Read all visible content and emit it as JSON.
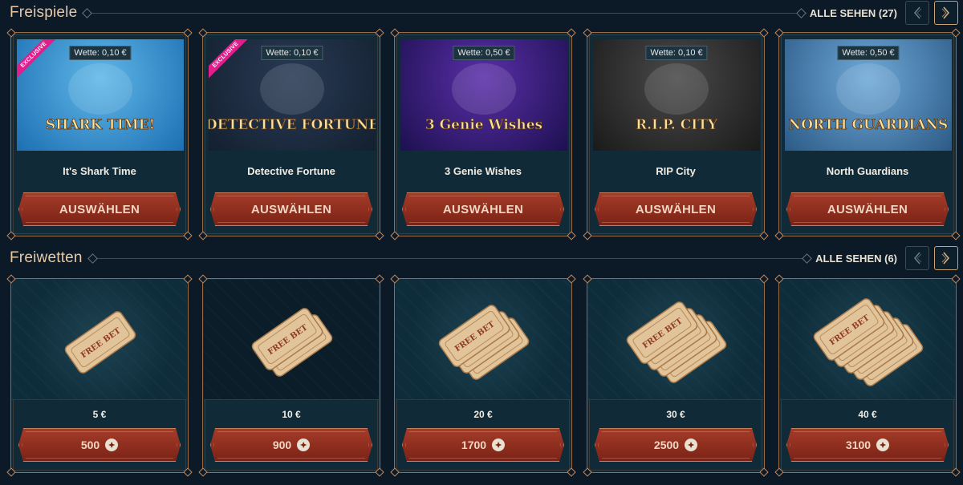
{
  "freespins": {
    "title": "Freispiele",
    "see_all": "ALLE SEHEN (27)",
    "select_label": "AUSWÄHLEN",
    "games": [
      {
        "name": "It's Shark Time",
        "wager": "Wette: 0,10 €",
        "exclusive": "EXCLUSIVE",
        "art_text": "SHARK TIME!",
        "colors": [
          "#5fb7e8",
          "#1d6fb2"
        ]
      },
      {
        "name": "Detective Fortune",
        "wager": "Wette: 0,10 €",
        "exclusive": "EXCLUSIVE",
        "art_text": "DETECTIVE FORTUNE",
        "colors": [
          "#2a3a55",
          "#12202f"
        ]
      },
      {
        "name": "3 Genie Wishes",
        "wager": "Wette: 0,50 €",
        "exclusive": "",
        "art_text": "3 Genie Wishes",
        "colors": [
          "#5a2fa8",
          "#1d1050"
        ]
      },
      {
        "name": "RIP City",
        "wager": "Wette: 0,10 €",
        "exclusive": "",
        "art_text": "R.I.P. CITY",
        "colors": [
          "#4a4a4a",
          "#1a1a1a"
        ]
      },
      {
        "name": "North Guardians",
        "wager": "Wette: 0,50 €",
        "exclusive": "",
        "art_text": "NORTH GUARDIANS",
        "colors": [
          "#6fa9d8",
          "#2c5a86"
        ]
      }
    ]
  },
  "freebets": {
    "title": "Freiwetten",
    "see_all": "ALLE SEHEN (6)",
    "ticket_text": "FREE BET",
    "bets": [
      {
        "amount": "5 €",
        "price": "500",
        "tickets": 1
      },
      {
        "amount": "10 €",
        "price": "900",
        "tickets": 2
      },
      {
        "amount": "20 €",
        "price": "1700",
        "tickets": 3
      },
      {
        "amount": "30 €",
        "price": "2500",
        "tickets": 4
      },
      {
        "amount": "40 €",
        "price": "3100",
        "tickets": 5
      }
    ]
  },
  "icons": {
    "prev": "chevron-left-icon",
    "next": "chevron-right-icon",
    "coin": "coin-icon"
  }
}
